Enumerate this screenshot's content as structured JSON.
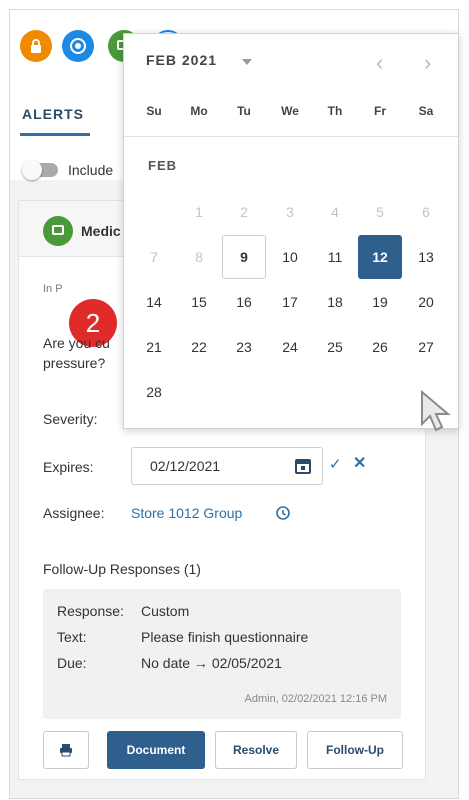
{
  "header": {
    "icons": [
      {
        "name": "lock-icon",
        "color": "#f08a00"
      },
      {
        "name": "target-icon",
        "color": "#1e88e5"
      },
      {
        "name": "chat-icon",
        "color": "#4a9a3a"
      },
      {
        "name": "info-icon",
        "color": "#1e88e5"
      }
    ],
    "alerts_tab": "ALERTS",
    "include_label": "Include"
  },
  "card": {
    "title": "Medic",
    "status": "In P",
    "badge": "2",
    "question_line1": "Are you cu",
    "question_line2": "pressure?",
    "severity_label": "Severity:",
    "expires_label": "Expires:",
    "expires_value": "02/12/2021",
    "assignee_label": "Assignee:",
    "assignee_value": "Store 1012 Group",
    "followup_title": "Follow-Up Responses (1)",
    "followup": {
      "response_label": "Response:",
      "response_value": "Custom",
      "text_label": "Text:",
      "text_value": "Please finish questionnaire",
      "due_label": "Due:",
      "due_value": "No date → 02/05/2021",
      "meta": "Admin, 02/02/2021 12:16 PM"
    },
    "buttons": {
      "document": "Document",
      "resolve": "Resolve",
      "followup": "Follow-Up"
    }
  },
  "datepicker": {
    "month_year": "FEB 2021",
    "month_label": "FEB",
    "prev": "‹",
    "next": "›",
    "weekdays": [
      "Su",
      "Mo",
      "Tu",
      "We",
      "Th",
      "Fr",
      "Sa"
    ],
    "weeks": [
      [
        "",
        "1",
        "2",
        "3",
        "4",
        "5",
        "6"
      ],
      [
        "7",
        "8",
        "9",
        "10",
        "11",
        "12",
        "13"
      ],
      [
        "14",
        "15",
        "16",
        "17",
        "18",
        "19",
        "20"
      ],
      [
        "21",
        "22",
        "23",
        "24",
        "25",
        "26",
        "27"
      ],
      [
        "28",
        "",
        "",
        "",
        "",
        "",
        ""
      ]
    ],
    "muted_days": [
      "1",
      "2",
      "3",
      "4",
      "5",
      "6",
      "7",
      "8"
    ],
    "today": "9",
    "selected": "12",
    "accent": "#2f5f8c"
  }
}
